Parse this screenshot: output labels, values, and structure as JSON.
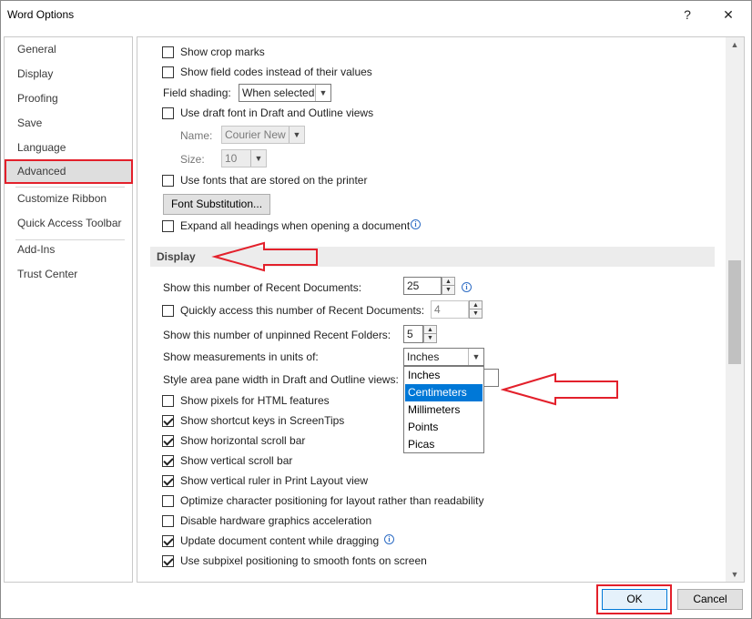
{
  "window": {
    "title": "Word Options",
    "help_label": "?",
    "close_label": "✕"
  },
  "nav": {
    "items": [
      {
        "label": "General"
      },
      {
        "label": "Display"
      },
      {
        "label": "Proofing"
      },
      {
        "label": "Save"
      },
      {
        "label": "Language"
      },
      {
        "label": "Advanced",
        "selected": true
      },
      {
        "label": "Customize Ribbon"
      },
      {
        "label": "Quick Access Toolbar"
      },
      {
        "label": "Add-Ins"
      },
      {
        "label": "Trust Center"
      }
    ]
  },
  "top_options": {
    "show_crop_marks": {
      "label": "Show crop marks",
      "checked": false
    },
    "show_field_codes": {
      "label": "Show field codes instead of their values",
      "checked": false
    },
    "field_shading": {
      "label": "Field shading:",
      "value": "When selected"
    },
    "draft_font": {
      "label": "Use draft font in Draft and Outline views",
      "checked": false
    },
    "name": {
      "label": "Name:",
      "value": "Courier New"
    },
    "size": {
      "label": "Size:",
      "value": "10"
    },
    "printer_fonts": {
      "label": "Use fonts that are stored on the printer",
      "checked": false
    },
    "font_substitution_button": "Font Substitution...",
    "expand_headings": {
      "label": "Expand all headings when opening a document",
      "checked": false
    }
  },
  "display_section": {
    "title": "Display",
    "recent_docs": {
      "label": "Show this number of Recent Documents:",
      "value": "25"
    },
    "quick_access": {
      "label": "Quickly access this number of Recent Documents:",
      "value": "4",
      "checked": false
    },
    "recent_folders": {
      "label": "Show this number of unpinned Recent Folders:",
      "value": "5"
    },
    "measurement_units": {
      "label": "Show measurements in units of:",
      "value": "Inches"
    },
    "style_area": {
      "label": "Style area pane width in Draft and Outline views:"
    },
    "pixels_html": {
      "label": "Show pixels for HTML features",
      "checked": false
    },
    "shortcut_keys": {
      "label": "Show shortcut keys in ScreenTips",
      "checked": true
    },
    "horizontal_scroll": {
      "label": "Show horizontal scroll bar",
      "checked": true
    },
    "vertical_scroll": {
      "label": "Show vertical scroll bar",
      "checked": true
    },
    "vertical_ruler": {
      "label": "Show vertical ruler in Print Layout view",
      "checked": true
    },
    "optimize_char": {
      "label": "Optimize character positioning for layout rather than readability",
      "checked": false
    },
    "disable_hw": {
      "label": "Disable hardware graphics acceleration",
      "checked": false
    },
    "update_dragging": {
      "label": "Update document content while dragging",
      "checked": true
    },
    "subpixel": {
      "label": "Use subpixel positioning to smooth fonts on screen",
      "checked": true
    }
  },
  "units_dropdown": {
    "options": [
      "Inches",
      "Centimeters",
      "Millimeters",
      "Points",
      "Picas"
    ],
    "highlighted": "Centimeters"
  },
  "footer": {
    "ok_label": "OK",
    "cancel_label": "Cancel"
  },
  "icons": {
    "info": "i",
    "combo_arrow": "▼",
    "spin_up": "▲",
    "spin_down": "▼",
    "scroll_up": "▲",
    "scroll_down": "▼"
  },
  "colors": {
    "highlight_red": "#e3202b",
    "selection_blue": "#0078d7"
  }
}
